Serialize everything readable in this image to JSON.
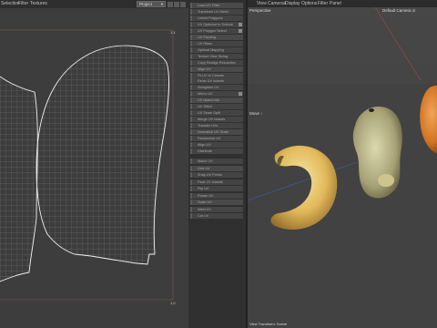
{
  "uv_editor": {
    "menu": [
      "Selection",
      "Filter",
      "Textures"
    ],
    "mode_select": "Project",
    "corner_labels": {
      "top_right": "1,1",
      "bottom_right": "1,0"
    }
  },
  "tool_list": {
    "items": [
      "Load UV Filter",
      "Transform UV Mesh",
      "Unfold Polygons",
      "UV Optimize to Texture",
      "UV Polygon Select",
      "UV Packing",
      "UV Relax",
      "Optimal Mapping",
      "Texture View Sizing",
      "Copy Realign Resolution",
      "Align UV",
      "Fit UV to Canvas",
      "Relax UV Islands",
      "Straighten UV",
      "Mirror UV",
      "UV Island Info",
      "UV Stitch",
      "UV Seam Split",
      "Merge UV Islands",
      "Transfer UVs",
      "Normalize UV Scale",
      "Randomize UV",
      "Align UV",
      "Distribute",
      "Match UV",
      "Grid UV",
      "Snap UV Points",
      "Pack UV Islands",
      "Flip UV",
      "Rotate UV",
      "Scale UV",
      "Weld UV",
      "Cut UV"
    ]
  },
  "viewport": {
    "menu": [
      "View",
      "Cameras",
      "Display",
      "Options",
      "Filter",
      "Panel"
    ],
    "view_name": "Perspective",
    "camera": "Default Camera ⊙",
    "axis_label": "Move ↑",
    "footer": "View Transform: Scene"
  }
}
